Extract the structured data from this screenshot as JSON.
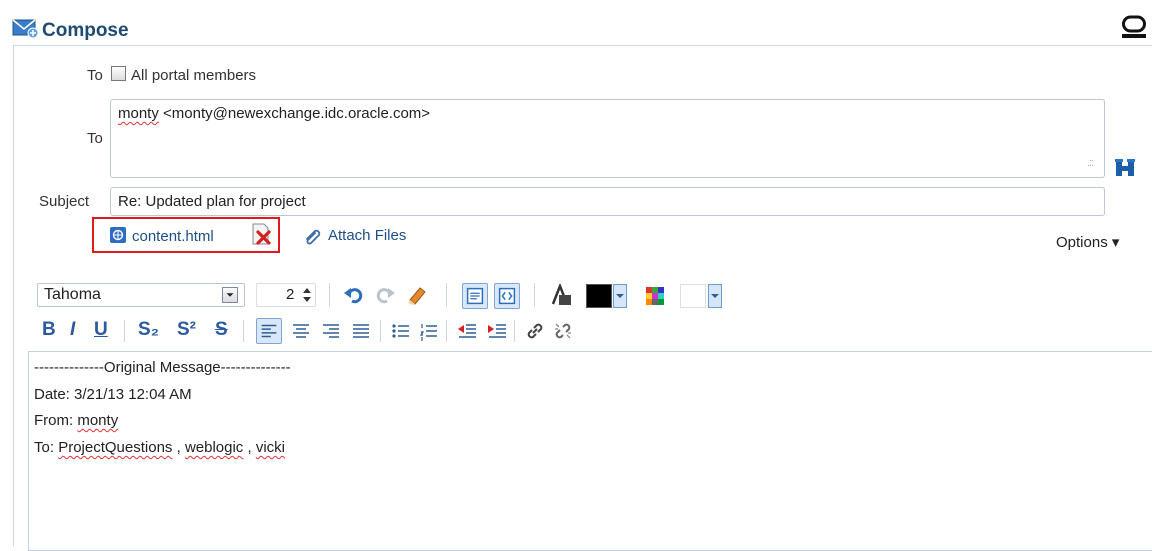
{
  "header": {
    "title": "Compose"
  },
  "form": {
    "to_label_1": "To",
    "all_members_label": "All portal members",
    "to_label_2": "To",
    "to_value": "monty <monty@newexchange.idc.oracle.com>",
    "subject_label": "Subject",
    "subject_value": "Re: Updated plan for project",
    "attachment_name": "content.html",
    "attach_files_label": "Attach Files",
    "options_label": "Options ▾"
  },
  "toolbar": {
    "font_name": "Tahoma",
    "font_size": "2",
    "text_color": "#000000",
    "bg_color": "#ffffff"
  },
  "format_bar": {
    "bold": "B",
    "italic": "I",
    "underline": "U",
    "subscript": "S₂",
    "superscript": "S²",
    "strikethrough": "S"
  },
  "editor": {
    "lines": [
      "--------------Original Message--------------",
      "Date: 3/21/13 12:04 AM",
      "From: monty",
      "To: ProjectQuestions , weblogic , vicki"
    ],
    "from_name": "monty",
    "to_prefix": "To: ",
    "to_name_1": "ProjectQuestions",
    "to_sep": " , ",
    "to_name_2": "weblogic",
    "to_name_3": "vicki",
    "from_prefix": "From: "
  },
  "colors": {
    "title": "#1f4a73",
    "link": "#1d4f86",
    "highlight_border": "#e01a1a"
  }
}
